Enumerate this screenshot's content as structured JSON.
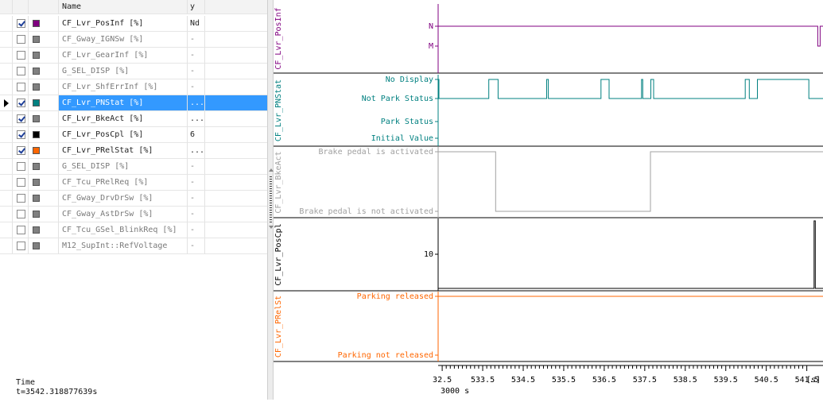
{
  "table": {
    "header": {
      "name": "Name",
      "y": "y"
    },
    "rows": [
      {
        "checked": true,
        "color": "#800080",
        "name": "CF_Lvr_PosInf [%]",
        "y": "Nd",
        "selected": false,
        "dim": false
      },
      {
        "checked": false,
        "color": "#808080",
        "name": "CF_Gway_IGNSw [%]",
        "y": "-",
        "selected": false,
        "dim": true
      },
      {
        "checked": false,
        "color": "#808080",
        "name": "CF_Lvr_GearInf [%]",
        "y": "-",
        "selected": false,
        "dim": true
      },
      {
        "checked": false,
        "color": "#808080",
        "name": "G_SEL_DISP [%]",
        "y": "-",
        "selected": false,
        "dim": true
      },
      {
        "checked": false,
        "color": "#808080",
        "name": "CF_Lvr_ShfErrInf [%]",
        "y": "-",
        "selected": false,
        "dim": true
      },
      {
        "checked": true,
        "color": "#008080",
        "name": "CF_Lvr_PNStat [%]",
        "y": "...",
        "selected": true,
        "dim": false
      },
      {
        "checked": true,
        "color": "#808080",
        "name": "CF_Lvr_BkeAct [%]",
        "y": "...",
        "selected": false,
        "dim": false
      },
      {
        "checked": true,
        "color": "#000000",
        "name": "CF_Lvr_PosCpl [%]",
        "y": "6",
        "selected": false,
        "dim": false
      },
      {
        "checked": true,
        "color": "#ff6600",
        "name": "CF_Lvr_PRelStat [%]",
        "y": "...",
        "selected": false,
        "dim": false
      },
      {
        "checked": false,
        "color": "#808080",
        "name": "G_SEL_DISP [%]",
        "y": "-",
        "selected": false,
        "dim": true
      },
      {
        "checked": false,
        "color": "#808080",
        "name": "CF_Tcu_PRelReq [%]",
        "y": "-",
        "selected": false,
        "dim": true
      },
      {
        "checked": false,
        "color": "#808080",
        "name": "CF_Gway_DrvDrSw [%]",
        "y": "-",
        "selected": false,
        "dim": true
      },
      {
        "checked": false,
        "color": "#808080",
        "name": "CF_Gway_AstDrSw [%]",
        "y": "-",
        "selected": false,
        "dim": true
      },
      {
        "checked": false,
        "color": "#808080",
        "name": "CF_Tcu_GSel_BlinkReq [%]",
        "y": "-",
        "selected": false,
        "dim": true
      },
      {
        "checked": false,
        "color": "#808080",
        "name": "M12_SupInt::RefVoltage",
        "y": "-",
        "selected": false,
        "dim": true
      }
    ]
  },
  "status": {
    "label": "Time",
    "value": "t=3542.318877639s"
  },
  "chart_data": {
    "type": "line",
    "x_offset_label": "3000 s",
    "x_unit": "[s]",
    "xlim": [
      532.4,
      541.9
    ],
    "xticks": [
      "32.5",
      "533.5",
      "534.5",
      "535.5",
      "536.5",
      "537.5",
      "538.5",
      "539.5",
      "540.5",
      "541.5"
    ],
    "panels": [
      {
        "signal": "CF_Lvr_PosInf",
        "color": "#800080",
        "labels": [
          "M",
          "N"
        ],
        "levels": [
          0,
          1
        ],
        "points": [
          [
            532.4,
            1
          ],
          [
            541.77,
            1
          ],
          [
            541.77,
            0
          ],
          [
            541.83,
            0
          ],
          [
            541.83,
            1
          ],
          [
            541.9,
            1
          ]
        ]
      },
      {
        "signal": "CF_Lvr_PNStat",
        "color": "#008080",
        "labels": [
          "No Display",
          "Not Park Status",
          "Park Status",
          "Initial Value"
        ],
        "levels": [
          3,
          2,
          1,
          0
        ],
        "points": [
          [
            532.4,
            3
          ],
          [
            532.42,
            3
          ],
          [
            532.42,
            2
          ],
          [
            533.65,
            2
          ],
          [
            533.65,
            3
          ],
          [
            533.88,
            3
          ],
          [
            533.88,
            2
          ],
          [
            535.08,
            2
          ],
          [
            535.08,
            3
          ],
          [
            535.12,
            3
          ],
          [
            535.12,
            2
          ],
          [
            536.42,
            2
          ],
          [
            536.42,
            3
          ],
          [
            536.62,
            3
          ],
          [
            536.62,
            2
          ],
          [
            537.42,
            2
          ],
          [
            537.42,
            3
          ],
          [
            537.45,
            3
          ],
          [
            537.45,
            2
          ],
          [
            537.65,
            2
          ],
          [
            537.65,
            3
          ],
          [
            537.72,
            3
          ],
          [
            537.72,
            2
          ],
          [
            539.98,
            2
          ],
          [
            539.98,
            3
          ],
          [
            540.08,
            3
          ],
          [
            540.08,
            2
          ],
          [
            540.28,
            2
          ],
          [
            540.28,
            3
          ],
          [
            541.55,
            3
          ],
          [
            541.55,
            2
          ],
          [
            541.9,
            2
          ]
        ]
      },
      {
        "signal": "CF_Lvr_BkeAct",
        "color": "#a0a0a0",
        "labels": [
          "Brake pedal is activated",
          "Brake pedal is not activated"
        ],
        "levels": [
          1,
          0
        ],
        "points": [
          [
            532.4,
            1
          ],
          [
            533.82,
            1
          ],
          [
            533.82,
            0
          ],
          [
            537.64,
            0
          ],
          [
            537.64,
            1
          ],
          [
            541.9,
            1
          ]
        ]
      },
      {
        "signal": "CF_Lvr_PosCpl",
        "color": "#000000",
        "labels": [
          "10"
        ],
        "levels": [
          10
        ],
        "points": [
          [
            532.4,
            6
          ],
          [
            541.68,
            6
          ],
          [
            541.68,
            15
          ],
          [
            541.71,
            15
          ],
          [
            541.71,
            6
          ],
          [
            541.9,
            6
          ]
        ]
      },
      {
        "signal": "CF_Lvr_PRelSt",
        "color": "#ff6600",
        "labels": [
          "Parking released",
          "Parking not released"
        ],
        "levels": [
          1,
          0
        ],
        "points": [
          [
            532.4,
            1
          ],
          [
            541.9,
            1
          ]
        ]
      }
    ]
  }
}
